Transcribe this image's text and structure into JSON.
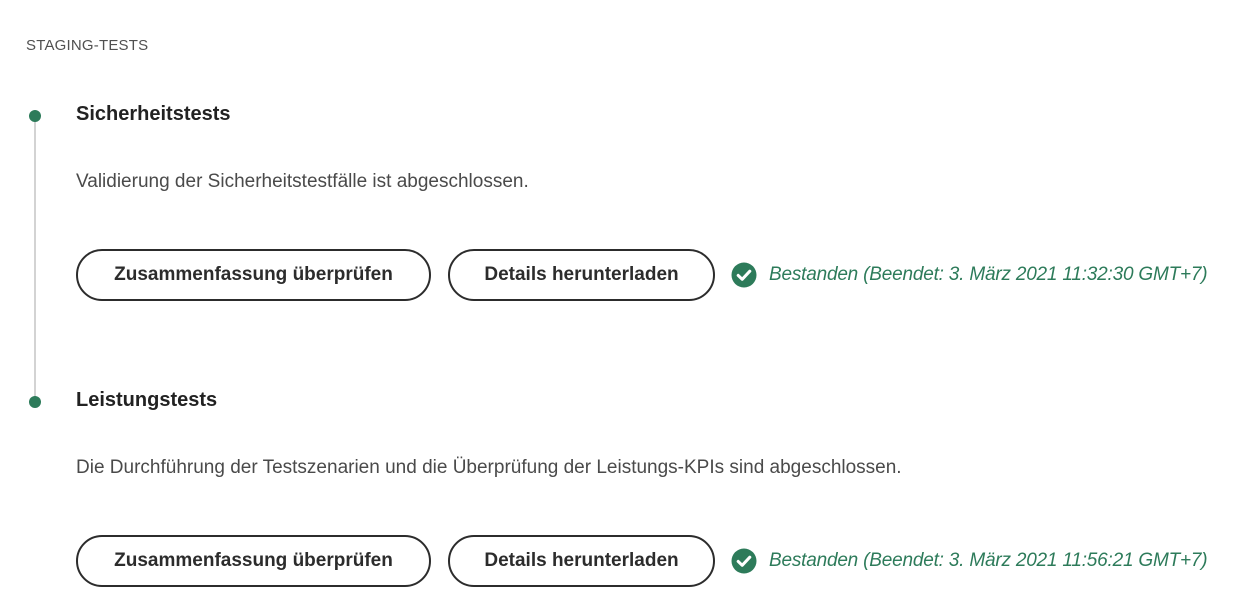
{
  "section": {
    "title": "STAGING-TESTS"
  },
  "steps": [
    {
      "title": "Sicherheitstests",
      "description": "Validierung der Sicherheitstestfälle ist abgeschlossen.",
      "summary_button": "Zusammenfassung überprüfen",
      "details_button": "Details herunterladen",
      "status_icon": "check-circle-icon",
      "status_text": "Bestanden (Beendet: 3. März 2021 11:32:30 GMT+7)"
    },
    {
      "title": "Leistungstests",
      "description": "Die Durchführung der Testszenarien und die Überprüfung der Leistungs-KPIs sind abgeschlossen.",
      "summary_button": "Zusammenfassung überprüfen",
      "details_button": "Details herunterladen",
      "status_icon": "check-circle-icon",
      "status_text": "Bestanden (Beendet: 3. März 2021 11:56:21 GMT+7)"
    }
  ],
  "colors": {
    "success": "#2d7b5a",
    "timeline_line": "#d3d3d3",
    "button_border": "#2c2c2c"
  }
}
